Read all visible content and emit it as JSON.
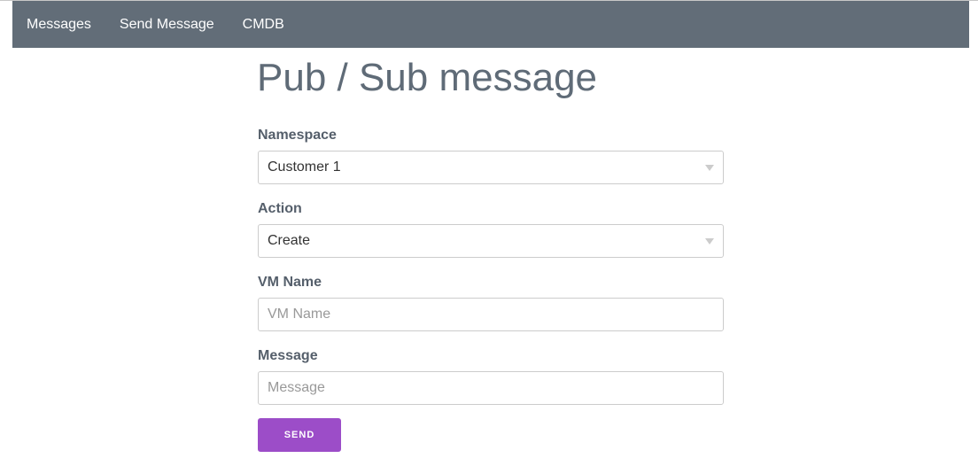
{
  "nav": {
    "items": [
      "Messages",
      "Send Message",
      "CMDB"
    ]
  },
  "page_title": "Pub / Sub message",
  "form": {
    "namespace": {
      "label": "Namespace",
      "value": "Customer 1"
    },
    "action": {
      "label": "Action",
      "value": "Create"
    },
    "vm_name": {
      "label": "VM Name",
      "placeholder": "VM Name"
    },
    "message": {
      "label": "Message",
      "placeholder": "Message"
    },
    "submit_label": "SEND"
  },
  "colors": {
    "navbar": "#626d78",
    "button": "#9c4dc8"
  }
}
